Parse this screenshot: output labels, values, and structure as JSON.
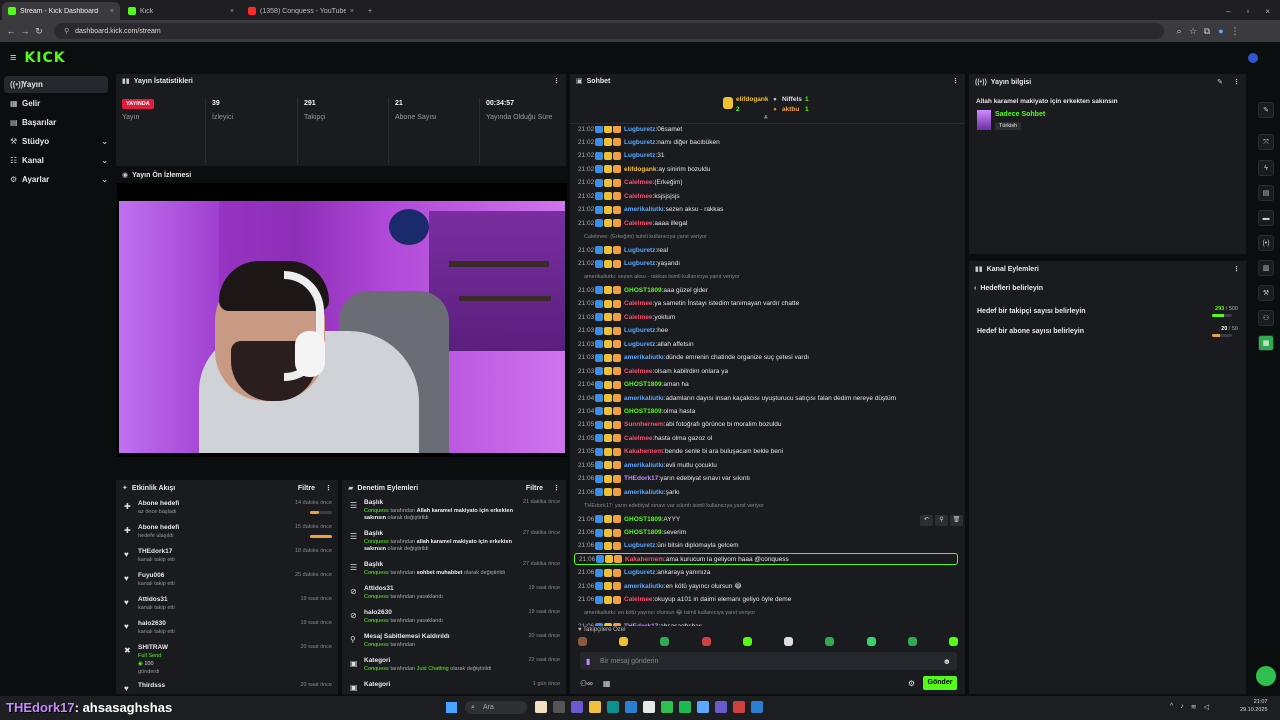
{
  "browser": {
    "tabs": [
      {
        "title": "Stream - Kick Dashboard",
        "color": "#53fc18"
      },
      {
        "title": "Kick",
        "color": "#53fc18"
      },
      {
        "title": "(1358) Conquess - YouTube",
        "color": "#ff2a2a"
      }
    ],
    "url": "dashboard.kick.com/stream"
  },
  "brand": {
    "logo": "KICK",
    "accent": "#53fc18"
  },
  "sidebar": {
    "items": [
      {
        "label": "Yayın",
        "icon": "broadcast-icon"
      },
      {
        "label": "Gelir",
        "icon": "income-icon"
      },
      {
        "label": "Başarılar",
        "icon": "achievements-icon"
      },
      {
        "label": "Stüdyo",
        "icon": "studio-icon"
      },
      {
        "label": "Kanal",
        "icon": "channel-icon"
      },
      {
        "label": "Ayarlar",
        "icon": "settings-icon"
      }
    ]
  },
  "stats": {
    "title": "Yayın İstatistikleri",
    "live": "YAYINDA",
    "live_label": "Yayın",
    "items": [
      {
        "value": "39",
        "label": "İzleyici"
      },
      {
        "value": "291",
        "label": "Takipçi"
      },
      {
        "value": "21",
        "label": "Abone Sayısı"
      },
      {
        "value": "00:34:57",
        "label": "Yayında Olduğu Süre"
      }
    ]
  },
  "preview": {
    "title": "Yayın Ön İzlemesi"
  },
  "feed": {
    "title": "Etkinlik Akışı",
    "filter": "Filtre",
    "items": [
      {
        "title": "Abone hedefi",
        "sub": "az önce başladı",
        "time": "14 dakika önce"
      },
      {
        "title": "Abone hedefi",
        "sub": "hedefe ulaşıldı",
        "time": "15 dakika önce"
      },
      {
        "title": "THEdork17",
        "sub": "kanalı takip etti",
        "time": "18 dakika önce"
      },
      {
        "title": "Fuyu006",
        "sub": "kanalı takip etti",
        "time": "25 dakika önce"
      },
      {
        "title": "Attidos31",
        "sub": "kanalı takip etti",
        "time": "19 saat önce"
      },
      {
        "title": "halo2630",
        "sub": "kanalı takip etti",
        "time": "19 saat önce"
      },
      {
        "title": "SHITRAW",
        "sub": "Full Send",
        "sub2": "100",
        "sub3": "gönderdi",
        "time": "20 saat önce"
      },
      {
        "title": "Thirdsss",
        "sub": "",
        "time": "20 saat önce"
      }
    ]
  },
  "mod": {
    "title": "Denetim Eylemleri",
    "filter": "Filtre",
    "items": [
      {
        "title": "Başlık",
        "who": "Conquess",
        "mid": "tarafından",
        "what": "Allah karamel makiyato için erkekten sakınsın",
        "end": "olarak değiştirildi",
        "time": "21 dakika önce"
      },
      {
        "title": "Başlık",
        "who": "Conquess",
        "mid": "tarafından",
        "what": "allah karamel makiyato için erkekten sakınsın",
        "end": "olarak değiştirildi",
        "time": "27 dakika önce"
      },
      {
        "title": "Başlık",
        "who": "Conquess",
        "mid": "tarafından",
        "what": "sohbet muhabbet",
        "end": "olarak değiştirildi",
        "time": "27 dakika önce"
      },
      {
        "title": "Attidos31",
        "who": "Conquess",
        "mid": "tarafından yasaklandı",
        "what": "",
        "end": "",
        "time": "19 saat önce"
      },
      {
        "title": "halo2630",
        "who": "Conquess",
        "mid": "tarafından yasaklandı",
        "what": "",
        "end": "",
        "time": "19 saat önce"
      },
      {
        "title": "Mesaj Sabitlemesi Kaldırıldı",
        "who": "Conquess",
        "mid": "tarafından",
        "what": "",
        "end": "",
        "time": "20 saat önce"
      },
      {
        "title": "Kategori",
        "who": "Conquess",
        "mid": "tarafından",
        "what": "Just Chatting",
        "end": "olarak değiştirildi",
        "time": "22 saat önce"
      },
      {
        "title": "Kategori",
        "who": "",
        "mid": "",
        "what": "",
        "end": "",
        "time": "1 gün önce"
      }
    ]
  },
  "chat": {
    "title": "Sohbet",
    "leaders": [
      {
        "name": "elifdogank",
        "count": "2"
      },
      {
        "name": "Niffels",
        "count": "1"
      },
      {
        "name": "aktbu",
        "count": "1"
      }
    ],
    "messages": [
      {
        "t": "21:02",
        "u": "Lugburetz",
        "c": "#5aa9ff",
        "m": "06samet"
      },
      {
        "t": "21:02",
        "u": "Lugburetz",
        "c": "#5aa9ff",
        "m": "namı diğer bacıbüken"
      },
      {
        "t": "21:02",
        "u": "Lugburetz",
        "c": "#5aa9ff",
        "m": "31"
      },
      {
        "t": "21:02",
        "u": "elifdogank",
        "c": "#f0c030",
        "m": "ay sinirim bozuldu"
      },
      {
        "t": "21:02",
        "u": "Calelmee",
        "c": "#ff4d6d",
        "m": "(Erkeğim)"
      },
      {
        "t": "21:02",
        "u": "Calelmee",
        "c": "#ff4d6d",
        "m": "ksjsjsjsjs"
      },
      {
        "t": "21:02",
        "u": "amerikaliutkı",
        "c": "#5aa9ff",
        "m": "sezen aksu - rakkas"
      },
      {
        "t": "21:02",
        "u": "Calelmee",
        "c": "#ff4d6d",
        "m": "aaaa illegal"
      },
      {
        "sys": "Calelmee: (Erkeğim) isimli kullanıcıya yanıt veriyor"
      },
      {
        "t": "21:02",
        "u": "Lugburetz",
        "c": "#5aa9ff",
        "m": "real"
      },
      {
        "t": "21:02",
        "u": "Lugburetz",
        "c": "#5aa9ff",
        "m": "yaşandı"
      },
      {
        "sys": "amerikaliutkı: sezen aksu - rakkas isimli kullanıcıya yanıt veriyor"
      },
      {
        "t": "21:03",
        "u": "GHOST1809",
        "c": "#53fc18",
        "m": "aaa güzel gider"
      },
      {
        "t": "21:03",
        "u": "Calelmee",
        "c": "#ff4d6d",
        "m": "ya sametin İnstayı istedim tanımayan vardır chatte"
      },
      {
        "t": "21:03",
        "u": "Calelmee",
        "c": "#ff4d6d",
        "m": "yoktum"
      },
      {
        "t": "21:03",
        "u": "Lugburetz",
        "c": "#5aa9ff",
        "m": "hee"
      },
      {
        "t": "21:03",
        "u": "Lugburetz",
        "c": "#5aa9ff",
        "m": "allah affetsin"
      },
      {
        "t": "21:03",
        "u": "amerikaliutkı",
        "c": "#5aa9ff",
        "m": "dünde emrenin chatinde organize suç çetesi vardı"
      },
      {
        "t": "21:03",
        "u": "Calelmee",
        "c": "#ff4d6d",
        "m": "olsam kabilrdim onlara ya"
      },
      {
        "t": "21:04",
        "u": "GHOST1809",
        "c": "#53fc18",
        "m": "aman ha"
      },
      {
        "t": "21:04",
        "u": "amerikaliutkı",
        "c": "#5aa9ff",
        "m": "adamların dayısı insan kaçakcısı uyuşturucu satıçısı falan dedim nereye düştüm"
      },
      {
        "t": "21:04",
        "u": "GHOST1809",
        "c": "#53fc18",
        "m": "olma hasta"
      },
      {
        "t": "21:05",
        "u": "Sunnhernem",
        "c": "#ff4d6d",
        "m": "abi fotoğrafı görünce bi moralim bozuldu"
      },
      {
        "t": "21:05",
        "u": "Calelmee",
        "c": "#ff4d6d",
        "m": "hasta olma gazoz ol"
      },
      {
        "t": "21:05",
        "u": "Kakahernem",
        "c": "#ff4d6d",
        "m": "bende senle bi ara buluşacam bekle beni"
      },
      {
        "t": "21:05",
        "u": "amerikaliutkı",
        "c": "#5aa9ff",
        "m": "evli mutlu çocuklu"
      },
      {
        "t": "21:06",
        "u": "THEdork17",
        "c": "#c58bff",
        "m": "yarın edebiyat sınavı var sıkıntı"
      },
      {
        "t": "21:06",
        "u": "amerikaliutkı",
        "c": "#5aa9ff",
        "m": "şarkı"
      },
      {
        "sys": "THEdork17: yarın edebiyat sınavı var sıkıntı isimli kullanıcıya yanıt veriyor"
      },
      {
        "t": "21:06",
        "u": "GHOST1809",
        "c": "#53fc18",
        "m": "AYYY"
      },
      {
        "t": "21:06",
        "u": "GHOST1809",
        "c": "#53fc18",
        "m": "severim"
      },
      {
        "t": "21:06",
        "u": "Lugburetz",
        "c": "#5aa9ff",
        "m": "üni bitsin diplomayla gelcem"
      },
      {
        "t": "21:06",
        "u": "Kakahernem",
        "c": "#ff4d6d",
        "m": "ama kurucum la geliyom haaa @conquess",
        "hl": true
      },
      {
        "t": "21:06",
        "u": "Lugburetz",
        "c": "#5aa9ff",
        "m": "ankaraya yanınıza"
      },
      {
        "t": "21:06",
        "u": "amerikaliutkı",
        "c": "#5aa9ff",
        "m": "en kötü yayıncı olursun 😂"
      },
      {
        "t": "21:06",
        "u": "Calelmee",
        "c": "#ff4d6d",
        "m": "okuyup a101 in daimi elemanı geliyo öyle deme"
      },
      {
        "sys": "amerikaliutkı: en kötü yayıncı olursun 😂 isimli kullanıcıya yanıt veriyor"
      },
      {
        "t": "21:06",
        "u": "THEdork17",
        "c": "#c58bff",
        "m": "ahsasaghshas"
      }
    ],
    "pinned": "Takipçilere Özel",
    "placeholder": "Bir mesaj gönderin",
    "send": "Gönder"
  },
  "info": {
    "title": "Yayın bilgisi",
    "stream_title": "Allah karamel makiyato için erkekten sakınsın",
    "category": "Sadece Sohbet",
    "tag": "Türkish"
  },
  "actions": {
    "title": "Kanal Eylemleri",
    "back": "Hedefleri belirleyin",
    "goals": [
      {
        "label": "Hedef bir takipçi sayısı belirleyin",
        "current": "293",
        "target": "500",
        "color": "#53fc18",
        "progress": 0.586
      },
      {
        "label": "Hedef bir abone sayısı belirleyin",
        "current": "20",
        "target": "50",
        "color": "#f0a040",
        "progress": 0.4
      }
    ]
  },
  "overlay": {
    "user": "THEdork17",
    "text": ": ahsasaghshas"
  },
  "taskbar": {
    "search": "Ara",
    "time": "21:07",
    "date": "29.10.2025"
  }
}
